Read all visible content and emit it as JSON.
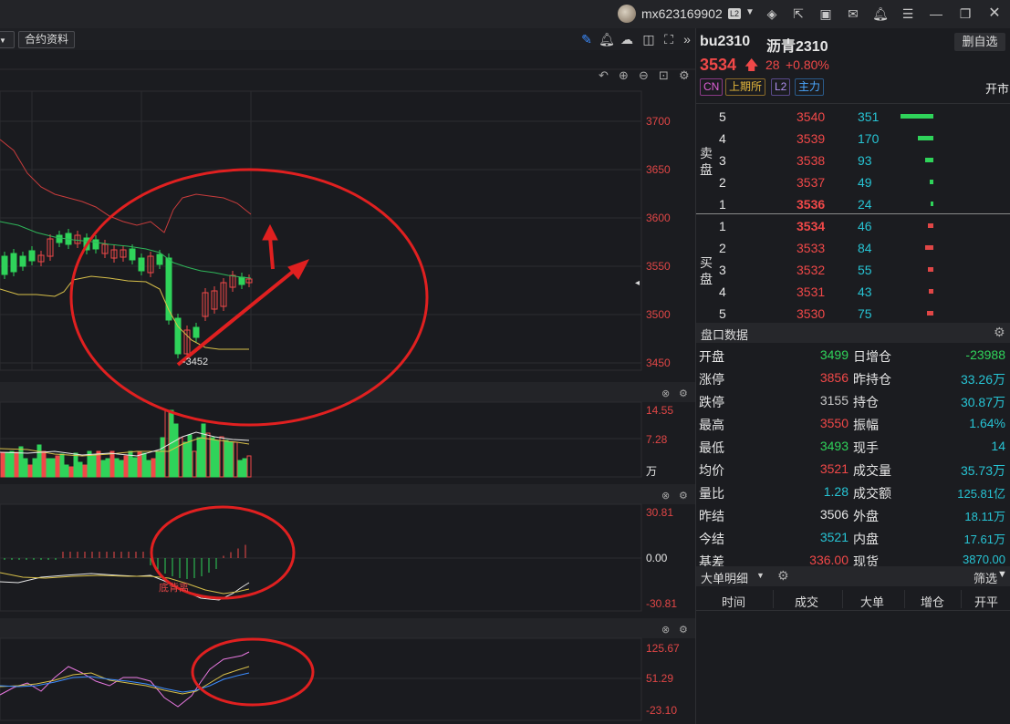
{
  "titlebar": {
    "username": "mx623169902",
    "level_badge": "L2"
  },
  "toolbar": {
    "contract_info_label": "合约资料"
  },
  "chart": {
    "price_axis": [
      "3700",
      "3650",
      "3600",
      "3550",
      "3500",
      "3450"
    ],
    "low_annotation": "-3452",
    "volume_axis": [
      "14.55",
      "7.28",
      "万"
    ],
    "macd_axis": [
      "30.81",
      "0.00",
      "-30.81"
    ],
    "macd_annotation": "底背离",
    "kdj_axis": [
      "125.67",
      "51.29",
      "-23.10"
    ]
  },
  "quote": {
    "code": "bu2310",
    "name": "沥青2310",
    "price": "3534",
    "change": "28",
    "change_pct": "+0.80%",
    "delete_button": "删自选",
    "tags": [
      "CN",
      "上期所",
      "L2",
      "主力"
    ],
    "market_status": "开市",
    "sell_label": "卖盘",
    "buy_label": "买盘",
    "asks": [
      {
        "level": "5",
        "price": "3540",
        "volume": "351",
        "bar": 1.0
      },
      {
        "level": "4",
        "price": "3539",
        "volume": "170",
        "bar": 0.48
      },
      {
        "level": "3",
        "price": "3538",
        "volume": "93",
        "bar": 0.26
      },
      {
        "level": "2",
        "price": "3537",
        "volume": "49",
        "bar": 0.12
      },
      {
        "level": "1",
        "price": "3536",
        "volume": "24",
        "bar": 0.05
      }
    ],
    "bids": [
      {
        "level": "1",
        "price": "3534",
        "volume": "46",
        "bar": 0.16
      },
      {
        "level": "2",
        "price": "3533",
        "volume": "84",
        "bar": 0.24
      },
      {
        "level": "3",
        "price": "3532",
        "volume": "55",
        "bar": 0.16
      },
      {
        "level": "4",
        "price": "3531",
        "volume": "43",
        "bar": 0.14
      },
      {
        "level": "5",
        "price": "3530",
        "volume": "75",
        "bar": 0.2
      }
    ]
  },
  "panel": {
    "title": "盘口数据",
    "rows": [
      {
        "l1": "开盘",
        "v1": "3499",
        "l2": "日增仓",
        "v2": "-23988"
      },
      {
        "l1": "涨停",
        "v1": "3856",
        "l2": "昨持仓",
        "v2": "33.26万"
      },
      {
        "l1": "跌停",
        "v1": "3155",
        "l2": "持仓",
        "v2": "30.87万"
      },
      {
        "l1": "最高",
        "v1": "3550",
        "l2": "振幅",
        "v2": "1.64%"
      },
      {
        "l1": "最低",
        "v1": "3493",
        "l2": "现手",
        "v2": "14"
      },
      {
        "l1": "均价",
        "v1": "3521",
        "l2": "成交量",
        "v2": "35.73万"
      },
      {
        "l1": "量比",
        "v1": "1.28",
        "l2": "成交额",
        "v2": "125.81亿"
      },
      {
        "l1": "昨结",
        "v1": "3506",
        "l2": "外盘",
        "v2": "18.11万"
      },
      {
        "l1": "今结",
        "v1": "3521",
        "l2": "内盘",
        "v2": "17.61万"
      },
      {
        "l1": "基差",
        "v1": "336.00",
        "l2": "现货",
        "v2": "3870.00"
      }
    ]
  },
  "bigorders": {
    "title": "大单明细",
    "filter": "筛选",
    "columns": [
      "时间",
      "成交",
      "大单",
      "增仓",
      "开平"
    ]
  }
}
